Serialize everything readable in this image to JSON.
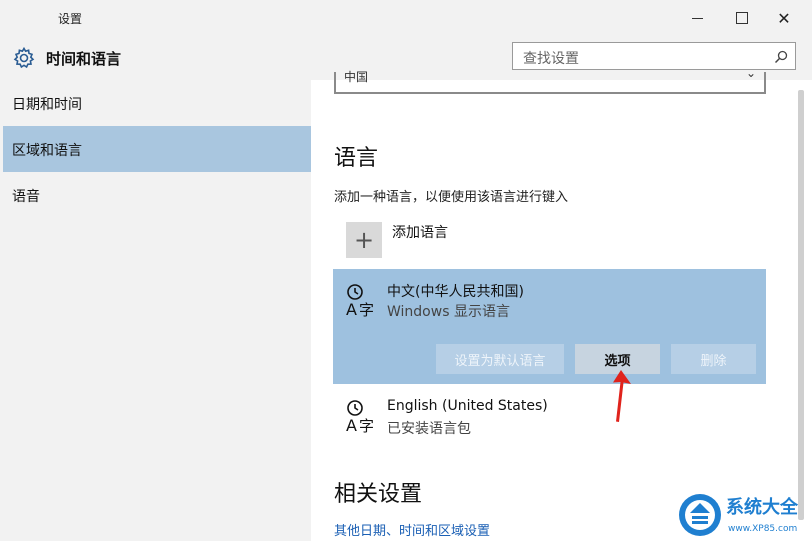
{
  "window": {
    "title": "设置",
    "minimize_icon": "minimize-icon",
    "maximize_icon": "maximize-icon",
    "close_icon": "close-icon",
    "close_glyph": "✕"
  },
  "header": {
    "title": "时间和语言",
    "icon": "gear-icon",
    "search_placeholder": "查找设置",
    "search_icon": "search-icon"
  },
  "sidebar": {
    "items": [
      {
        "label": "日期和时间",
        "active": false
      },
      {
        "label": "区域和语言",
        "active": true
      },
      {
        "label": "语音",
        "active": false
      }
    ],
    "active_color": "#a9c6df"
  },
  "content": {
    "region_value": "中国",
    "language_heading": "语言",
    "language_desc": "添加一种语言，以便使用该语言进行键入",
    "add_language": "添加语言",
    "add_glyph": "+",
    "languages": [
      {
        "name": "中文(中华人民共和国)",
        "sub": "Windows 显示语言",
        "icon": "language-icon",
        "selected": true
      },
      {
        "name": "English (United States)",
        "sub": "已安装语言包",
        "icon": "language-icon",
        "selected": false
      }
    ],
    "actions": {
      "set_default": "设置为默认语言",
      "options": "选项",
      "remove": "删除"
    },
    "selected_color": "#9ec1df",
    "related_heading": "相关设置",
    "related_link": "其他日期、时间和区域设置",
    "link_color": "#1a5fb4"
  },
  "watermark": {
    "title": "系统大全",
    "url": "www.XP85.com",
    "color": "#1f7fd0"
  }
}
